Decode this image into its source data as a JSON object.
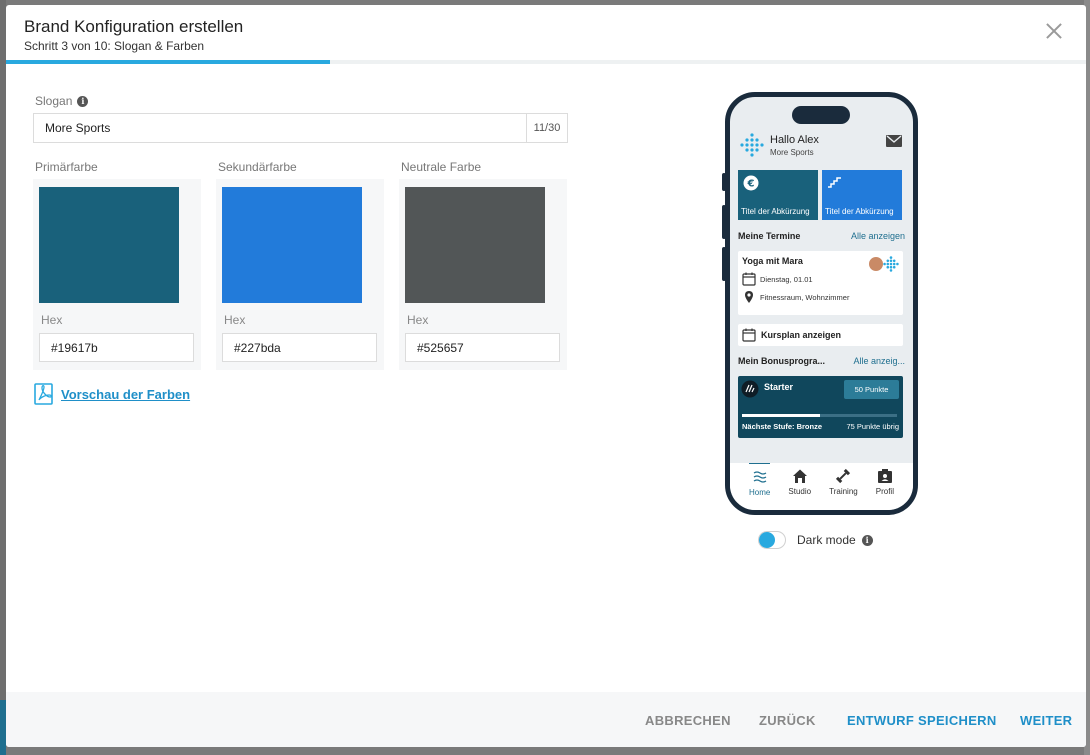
{
  "modal": {
    "title": "Brand Konfiguration erstellen",
    "subtitle": "Schritt 3 von 10: Slogan & Farben",
    "progress": 0.3
  },
  "slogan": {
    "label": "Slogan",
    "value": "More Sports",
    "counter": "11/30"
  },
  "colors": [
    {
      "label": "Primärfarbe",
      "hex_label": "Hex",
      "hex": "#19617b"
    },
    {
      "label": "Sekundärfarbe",
      "hex_label": "Hex",
      "hex": "#227bda"
    },
    {
      "label": "Neutrale Farbe",
      "hex_label": "Hex",
      "hex": "#525657"
    }
  ],
  "preview_link": "Vorschau der Farben",
  "phone": {
    "greeting": "Hallo Alex",
    "studio": "More Sports",
    "tiles": [
      {
        "label": "Titel der Abkürzung",
        "icon": "euro-icon"
      },
      {
        "label": "Titel der Abkürzung",
        "icon": "stairs-icon"
      }
    ],
    "appointments_title": "Meine Termine",
    "appointments_link": "Alle anzeigen",
    "appointment": {
      "title": "Yoga mit Mara",
      "date": "Dienstag, 01.01",
      "location": "Fitnessraum, Wohnzimmer"
    },
    "schedule_link": "Kursplan anzeigen",
    "bonus_title": "Mein Bonusprogra...",
    "bonus_link": "Alle anzeig...",
    "bonus": {
      "level": "Starter",
      "points": "50 Punkte",
      "progress": 0.5,
      "next": "Nächste Stufe: Bronze",
      "remaining": "75 Punkte übrig"
    },
    "nav": [
      {
        "label": "Home",
        "icon": "home-waves-icon",
        "active": true
      },
      {
        "label": "Studio",
        "icon": "house-icon",
        "active": false
      },
      {
        "label": "Training",
        "icon": "dumbbell-icon",
        "active": false
      },
      {
        "label": "Profil",
        "icon": "profile-icon",
        "active": false
      }
    ]
  },
  "dark_mode": {
    "label": "Dark mode",
    "on": false
  },
  "footer": {
    "cancel": "ABBRECHEN",
    "back": "ZURÜCK",
    "save_draft": "ENTWURF SPEICHERN",
    "next": "WEITER"
  },
  "theme": {
    "accent": "#29a9df",
    "link": "#1f8fc8",
    "muted_button": "#888888",
    "primary_button": "#1f8fc8"
  }
}
